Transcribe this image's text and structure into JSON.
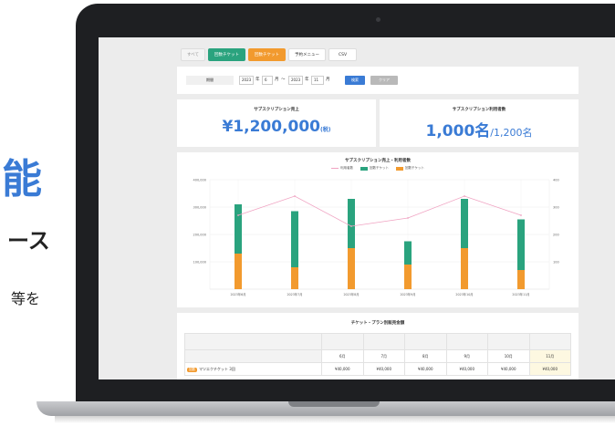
{
  "marketing": {
    "headline_fragment": "能",
    "subline_fragment": "ース",
    "body_fragment": "等を"
  },
  "app": {
    "tabs": [
      {
        "label": "すべて",
        "style": "plain-grey"
      },
      {
        "label": "回数チケット",
        "style": "green"
      },
      {
        "label": "回数チケット",
        "style": "orange"
      },
      {
        "label": "予約メニュー",
        "style": "plain"
      },
      {
        "label": "CSV",
        "style": "plain"
      }
    ],
    "filter": {
      "label": "期間",
      "from_year": "2023",
      "year_unit": "年",
      "from_month": "6",
      "month_unit": "月",
      "separator": "〜",
      "to_year": "2023",
      "to_month": "11",
      "search_label": "検索",
      "clear_label": "クリア"
    },
    "kpi_sales": {
      "title": "サブスクリプション売上",
      "value": "¥1,200,000",
      "unit": "(税)"
    },
    "kpi_users": {
      "title": "サブスクリプション利用者数",
      "value": "1,000名",
      "sub": "/1,200名"
    },
    "table": {
      "title": "チケット・プラン別販売金額",
      "months": [
        "6月",
        "7月",
        "8月",
        "9月",
        "10月",
        "11月"
      ],
      "rows": [
        {
          "badge": "回数",
          "name": "マツエクチケット 3回",
          "values": [
            "¥40,000",
            "¥40,000",
            "¥40,000",
            "¥40,000",
            "¥40,000",
            "¥40,000"
          ]
        }
      ]
    }
  },
  "chart_data": {
    "type": "bar",
    "title": "サブスクリプション売上・利用者数",
    "legend": [
      "利用者数",
      "回数チケット",
      "回数チケット"
    ],
    "series_colors": {
      "line": "#f0a3c2",
      "green": "#2aa37e",
      "orange": "#f29a2e"
    },
    "categories": [
      "2023年6月",
      "2023年7月",
      "2023年8月",
      "2023年9月",
      "2023年10月",
      "2023年11月"
    ],
    "series": [
      {
        "values": [
          130000,
          80000,
          150000,
          90000,
          150000,
          70000
        ]
      },
      {
        "values": [
          180000,
          205000,
          180000,
          85000,
          180000,
          185000
        ]
      },
      {
        "values": [
          270,
          340,
          230,
          260,
          340,
          270
        ]
      }
    ],
    "y_left_ticks": [
      "400,000",
      "300,000",
      "200,000",
      "100,000"
    ],
    "y_right_ticks": [
      "400",
      "300",
      "200",
      "100"
    ],
    "ylim_left": [
      0,
      400000
    ],
    "ylim_right": [
      0,
      400
    ],
    "stacked": true,
    "legend_position": "top"
  }
}
